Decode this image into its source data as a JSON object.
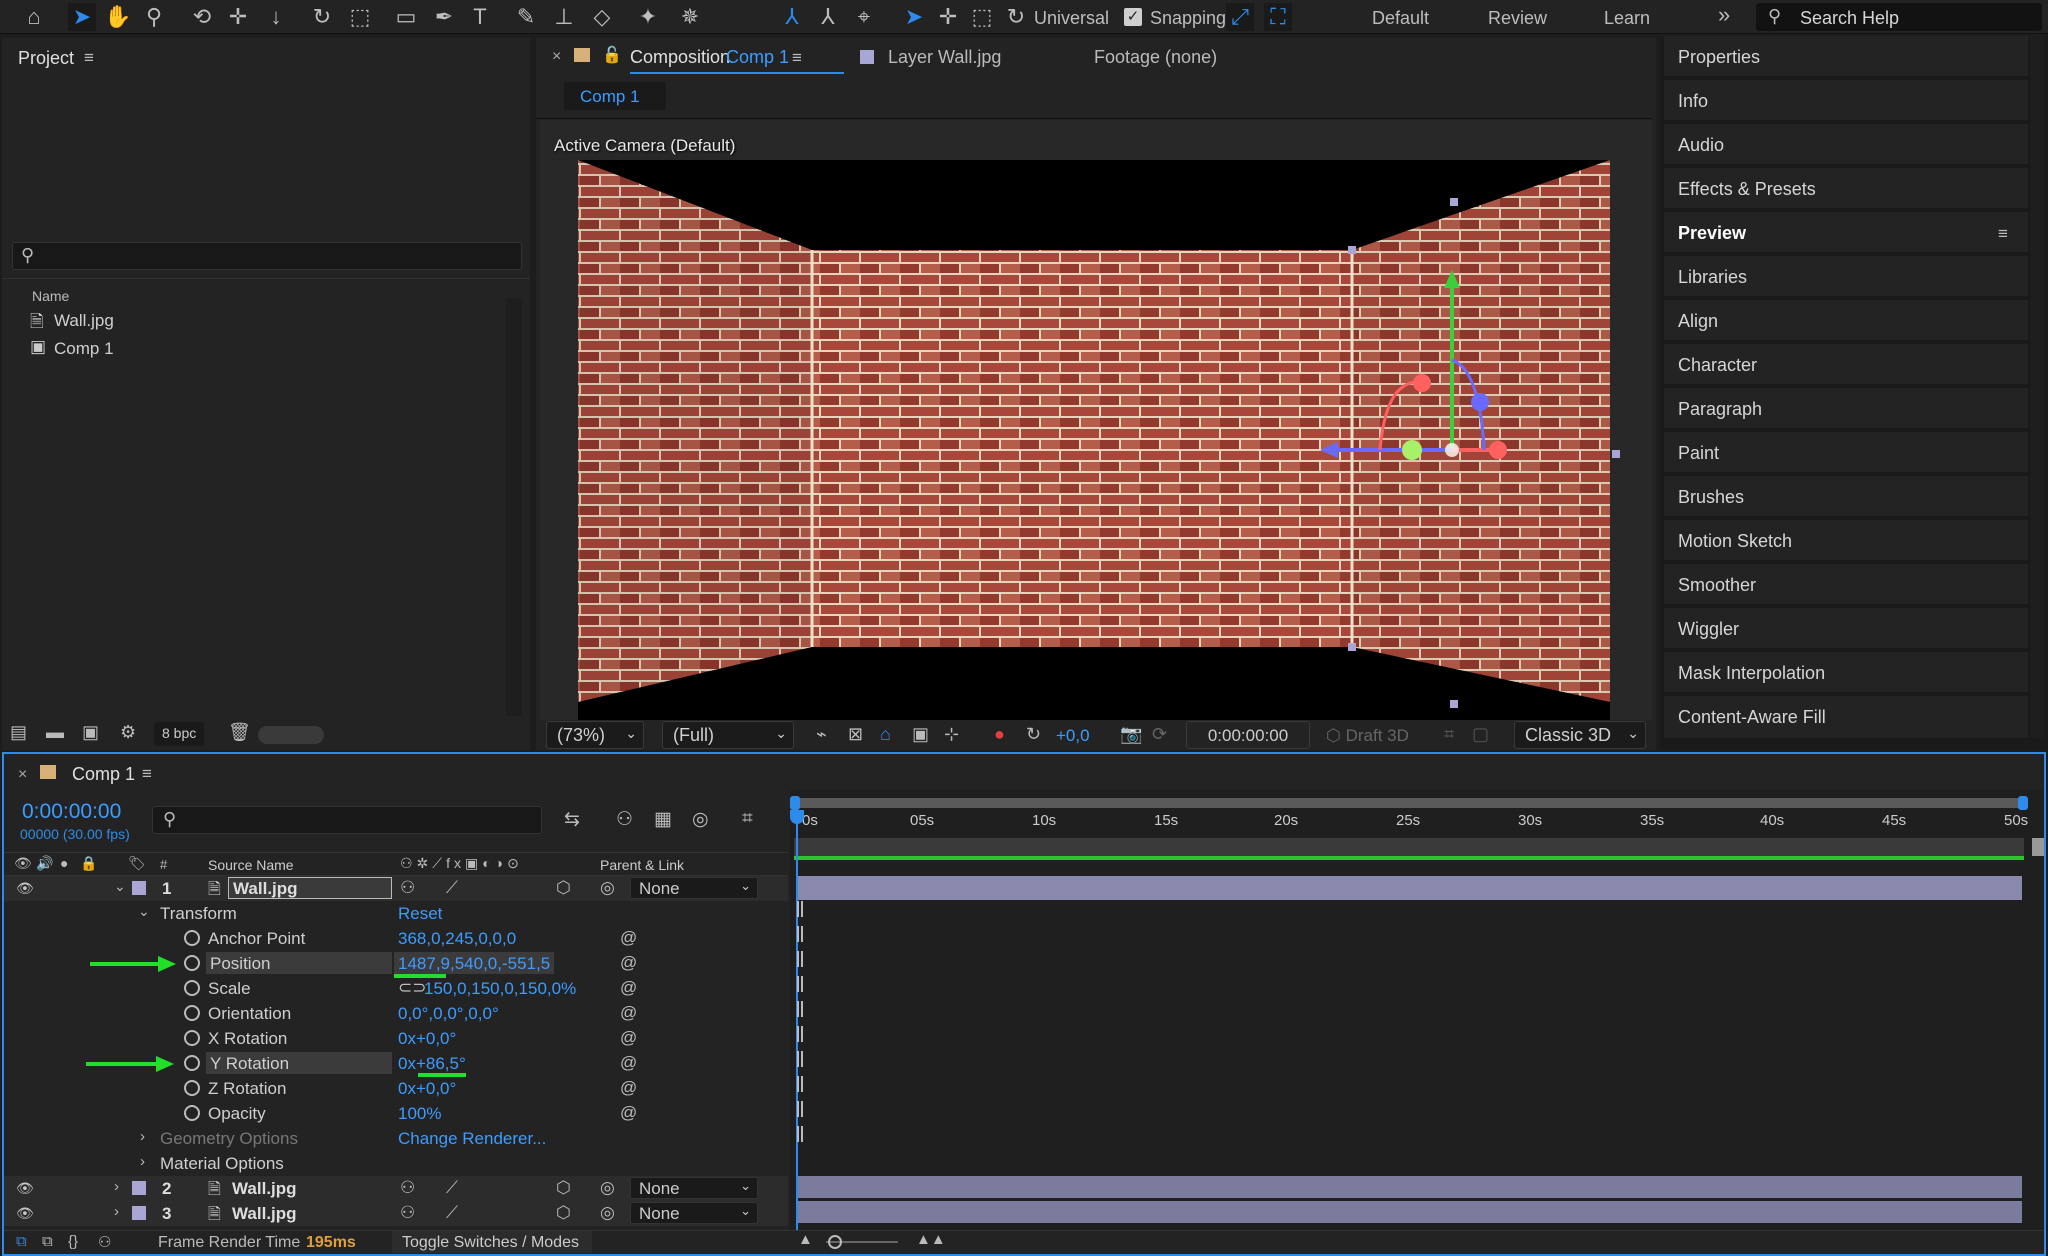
{
  "toolbar": {
    "universal_label": "Universal",
    "snapping_label": "Snapping",
    "workspaces": [
      "Default",
      "Review",
      "Learn"
    ],
    "more": "»",
    "search_placeholder": "Search Help"
  },
  "project": {
    "title": "Project",
    "column_name": "Name",
    "items": [
      {
        "name": "Wall.jpg",
        "icon": "image-file-icon"
      },
      {
        "name": "Comp 1",
        "icon": "composition-icon"
      }
    ],
    "bpc": "8 bpc"
  },
  "comp_panel": {
    "tab_title": "Composition",
    "tab_comp": "Comp 1",
    "layer_tab": "Layer Wall.jpg",
    "footage_tab": "Footage (none)",
    "flow_tab": "Comp 1",
    "camera_label": "Active Camera (Default)",
    "zoom": "(73%)",
    "resolution": "(Full)",
    "exposure": "+0,0",
    "timecode": "0:00:00:00",
    "draft3d": "Draft 3D",
    "renderer": "Classic 3D"
  },
  "right_panel": {
    "items": [
      "Properties",
      "Info",
      "Audio",
      "Effects & Presets",
      "Preview",
      "Libraries",
      "Align",
      "Character",
      "Paragraph",
      "Paint",
      "Brushes",
      "Motion Sketch",
      "Smoother",
      "Wiggler",
      "Mask Interpolation",
      "Content-Aware Fill"
    ]
  },
  "timeline": {
    "tab": "Comp 1",
    "timecode": "0:00:00:00",
    "fps": "00000 (30.00 fps)",
    "col_source": "Source Name",
    "col_parent": "Parent & Link",
    "col_num": "#",
    "ruler": [
      "0s",
      "05s",
      "10s",
      "15s",
      "20s",
      "25s",
      "30s",
      "35s",
      "40s",
      "45s",
      "50s"
    ],
    "layer1": {
      "num": "1",
      "name": "Wall.jpg",
      "parent": "None"
    },
    "transform": "Transform",
    "reset": "Reset",
    "props": [
      {
        "name": "Anchor Point",
        "value": "368,0,245,0,0,0"
      },
      {
        "name": "Position",
        "value": "1487,9,540,0,-551,5"
      },
      {
        "name": "Scale",
        "value": "150,0,150,0,150,0%"
      },
      {
        "name": "Orientation",
        "value": "0,0°,0,0°,0,0°"
      },
      {
        "name": "X Rotation",
        "value": "0x+0,0°"
      },
      {
        "name": "Y Rotation",
        "value": "0x+86,5°"
      },
      {
        "name": "Z Rotation",
        "value": "0x+0,0°"
      },
      {
        "name": "Opacity",
        "value": "100%"
      }
    ],
    "geometry_options": "Geometry Options",
    "change_renderer": "Change Renderer...",
    "material_options": "Material Options",
    "layer2": {
      "num": "2",
      "name": "Wall.jpg",
      "parent": "None"
    },
    "layer3": {
      "num": "3",
      "name": "Wall.jpg",
      "parent": "None"
    },
    "frame_render_label": "Frame Render Time",
    "frame_render_value": "195ms",
    "toggle_label": "Toggle Switches / Modes"
  },
  "colors": {
    "accent": "#2d8ceb",
    "highlight_arrow": "#22e02a",
    "layer_label": "#a9a6d6"
  }
}
